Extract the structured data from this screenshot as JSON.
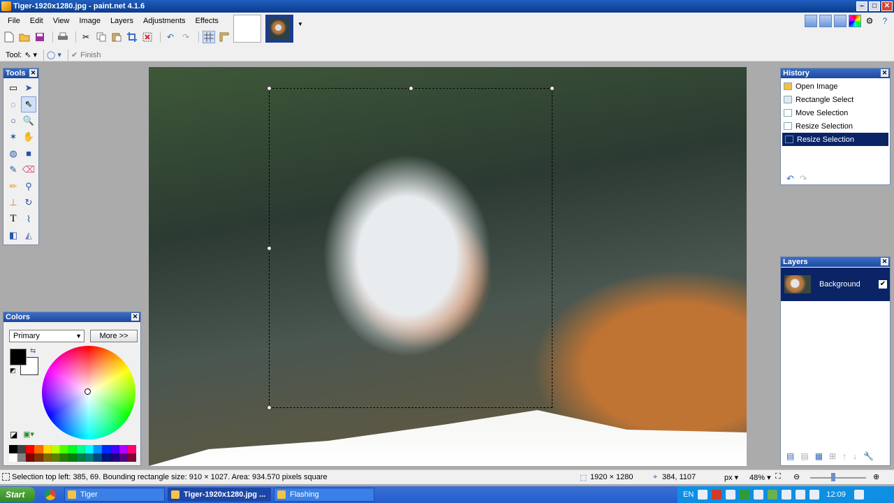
{
  "window": {
    "title": "Tiger-1920x1280.jpg - paint.net 4.1.6",
    "controls": [
      "–",
      "□",
      "✕"
    ]
  },
  "menu": [
    "File",
    "Edit",
    "View",
    "Image",
    "Layers",
    "Adjustments",
    "Effects"
  ],
  "toolbar2": {
    "tool_label": "Tool:",
    "finish_label": "Finish"
  },
  "panels": {
    "tools_title": "Tools",
    "colors_title": "Colors",
    "history_title": "History",
    "layers_title": "Layers"
  },
  "colors": {
    "mode_select": "Primary",
    "more_button": "More >>",
    "primary": "#000000",
    "secondary": "#ffffff",
    "palette": [
      "#000000",
      "#404040",
      "#ff0000",
      "#ff6a00",
      "#ffd800",
      "#b6ff00",
      "#4cff00",
      "#00ff21",
      "#00ff90",
      "#00ffff",
      "#0094ff",
      "#0026ff",
      "#4800ff",
      "#b200ff",
      "#ff006e",
      "#ffffff",
      "#808080",
      "#7f0000",
      "#7f3300",
      "#7f6a00",
      "#5b7f00",
      "#267f00",
      "#007f0e",
      "#007f46",
      "#007f7f",
      "#004a7f",
      "#00137f",
      "#21007f",
      "#57007f",
      "#7f0037"
    ]
  },
  "history": {
    "items": [
      {
        "label": "Open Image",
        "icon": "folder-icon"
      },
      {
        "label": "Rectangle Select",
        "icon": "rectangle-select-icon"
      },
      {
        "label": "Move Selection",
        "icon": "move-selection-icon"
      },
      {
        "label": "Resize Selection",
        "icon": "move-selection-icon"
      },
      {
        "label": "Resize Selection",
        "icon": "move-selection-icon",
        "selected": true
      }
    ]
  },
  "layers": {
    "items": [
      {
        "name": "Background",
        "visible": true
      }
    ]
  },
  "status": {
    "selection_info": "Selection top left: 385, 69. Bounding rectangle size: 910 × 1027. Area: 934.570 pixels square",
    "image_size": "1920 × 1280",
    "cursor_position": "384, 1107",
    "unit": "px",
    "zoom": "48%"
  },
  "taskbar": {
    "start_label": "Start",
    "tasks": [
      {
        "label": "Tiger",
        "active": false
      },
      {
        "label": "Tiger-1920x1280.jpg ...",
        "active": true
      },
      {
        "label": "Flashing",
        "active": false
      }
    ],
    "language": "EN",
    "clock": "12:09"
  }
}
